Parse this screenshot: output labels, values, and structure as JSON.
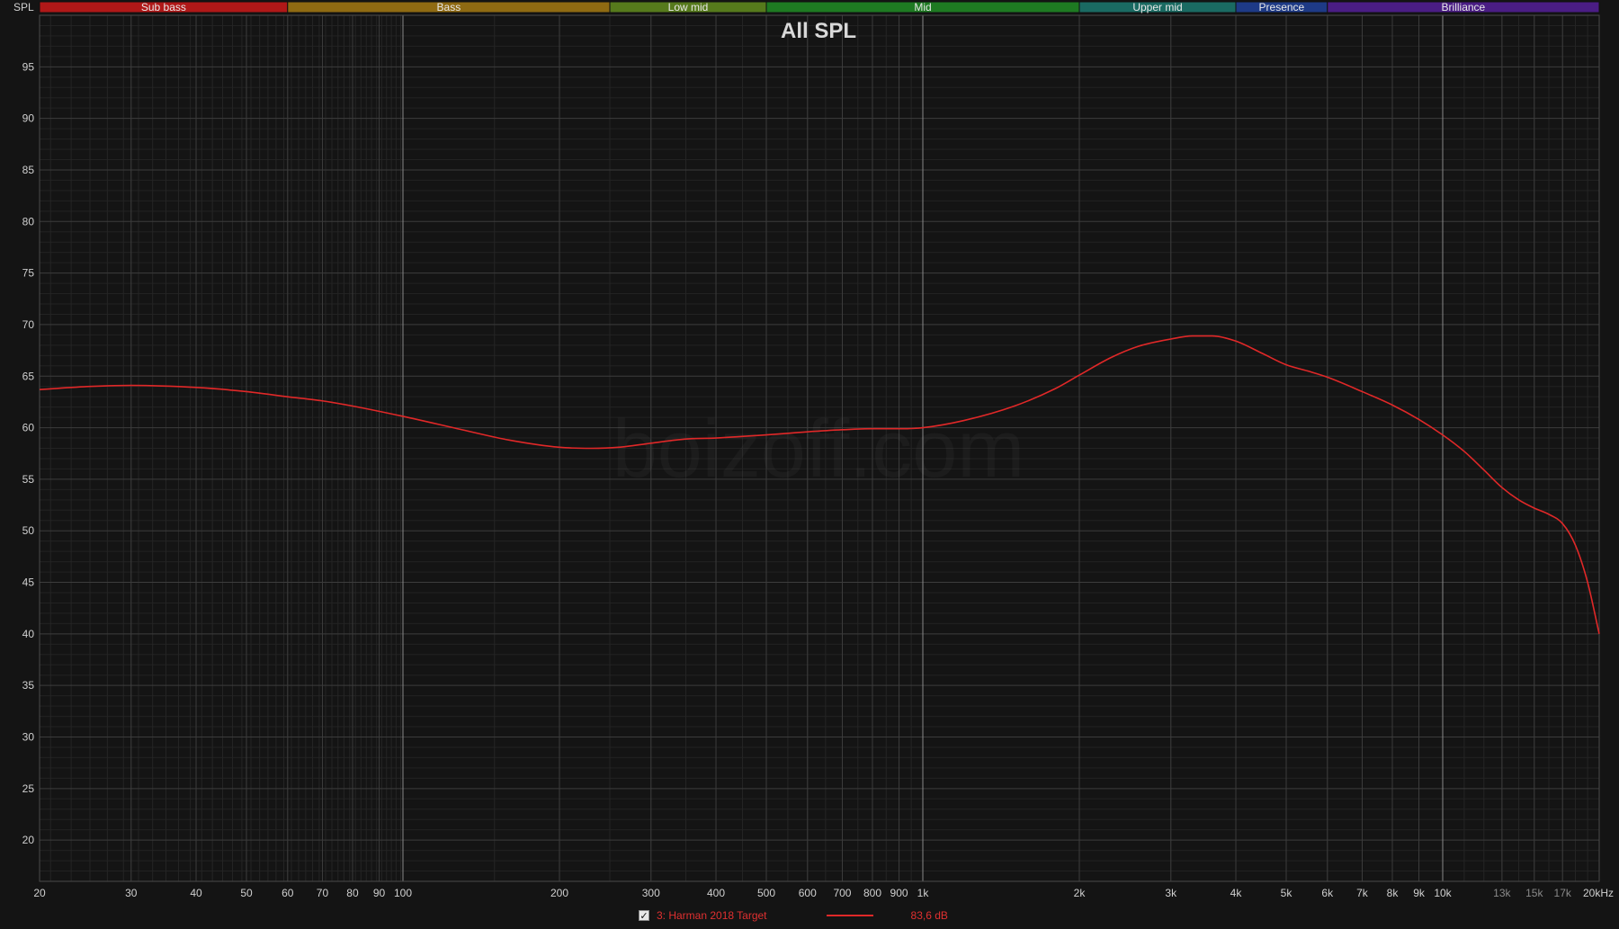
{
  "chart_data": {
    "type": "line",
    "title": "All SPL",
    "ylabel": "SPL",
    "xunit_label": "20kHz",
    "xscale": "log",
    "xlim": [
      20,
      20000
    ],
    "ylim": [
      16,
      100
    ],
    "grid": true,
    "watermark": "boizoff.com",
    "y_ticks": [
      20,
      25,
      30,
      35,
      40,
      45,
      50,
      55,
      60,
      65,
      70,
      75,
      80,
      85,
      90,
      95
    ],
    "x_ticks": [
      {
        "value": 20,
        "label": "20"
      },
      {
        "value": 30,
        "label": "30"
      },
      {
        "value": 40,
        "label": "40"
      },
      {
        "value": 50,
        "label": "50"
      },
      {
        "value": 60,
        "label": "60"
      },
      {
        "value": 70,
        "label": "70"
      },
      {
        "value": 80,
        "label": "80"
      },
      {
        "value": 90,
        "label": "90"
      },
      {
        "value": 100,
        "label": "100"
      },
      {
        "value": 200,
        "label": "200"
      },
      {
        "value": 300,
        "label": "300"
      },
      {
        "value": 400,
        "label": "400"
      },
      {
        "value": 500,
        "label": "500"
      },
      {
        "value": 600,
        "label": "600"
      },
      {
        "value": 700,
        "label": "700"
      },
      {
        "value": 800,
        "label": "800"
      },
      {
        "value": 900,
        "label": "900"
      },
      {
        "value": 1000,
        "label": "1k"
      },
      {
        "value": 2000,
        "label": "2k"
      },
      {
        "value": 3000,
        "label": "3k"
      },
      {
        "value": 4000,
        "label": "4k"
      },
      {
        "value": 5000,
        "label": "5k"
      },
      {
        "value": 6000,
        "label": "6k"
      },
      {
        "value": 7000,
        "label": "7k"
      },
      {
        "value": 8000,
        "label": "8k"
      },
      {
        "value": 9000,
        "label": "9k"
      },
      {
        "value": 10000,
        "label": "10k"
      },
      {
        "value": 13000,
        "label": "13k",
        "dim": true
      },
      {
        "value": 15000,
        "label": "15k",
        "dim": true
      },
      {
        "value": 17000,
        "label": "17k",
        "dim": true
      }
    ],
    "bands": [
      {
        "name": "Sub bass",
        "from": 20,
        "to": 60,
        "color": "#b01818"
      },
      {
        "name": "Bass",
        "from": 60,
        "to": 250,
        "color": "#8f6a12"
      },
      {
        "name": "Low mid",
        "from": 250,
        "to": 500,
        "color": "#567a1c"
      },
      {
        "name": "Mid",
        "from": 500,
        "to": 2000,
        "color": "#1e7a22"
      },
      {
        "name": "Upper mid",
        "from": 2000,
        "to": 4000,
        "color": "#1a6a62"
      },
      {
        "name": "Presence",
        "from": 4000,
        "to": 6000,
        "color": "#1e3a86"
      },
      {
        "name": "Brilliance",
        "from": 6000,
        "to": 20000,
        "color": "#4a1d84"
      }
    ],
    "series": [
      {
        "name": "3: Harman 2018 Target",
        "color": "#e02828",
        "value_label": "83,6 dB",
        "checked": true,
        "x": [
          20,
          25,
          30,
          40,
          50,
          60,
          70,
          80,
          100,
          130,
          160,
          200,
          230,
          260,
          300,
          350,
          400,
          500,
          600,
          700,
          800,
          900,
          1000,
          1200,
          1500,
          1800,
          2000,
          2300,
          2600,
          3000,
          3300,
          3600,
          4000,
          4500,
          5000,
          5500,
          6000,
          7000,
          8000,
          9000,
          10000,
          11000,
          12000,
          13000,
          14000,
          15000,
          16000,
          17000,
          18000,
          19000,
          20000
        ],
        "y": [
          63.7,
          64.0,
          64.1,
          63.9,
          63.5,
          63.0,
          62.6,
          62.1,
          61.1,
          59.8,
          58.8,
          58.1,
          58.0,
          58.1,
          58.5,
          58.9,
          59.0,
          59.3,
          59.6,
          59.8,
          59.9,
          59.9,
          60.0,
          60.7,
          62.1,
          63.8,
          65.1,
          66.8,
          67.9,
          68.6,
          68.9,
          68.9,
          68.4,
          67.2,
          66.1,
          65.5,
          64.9,
          63.5,
          62.2,
          60.8,
          59.3,
          57.7,
          55.9,
          54.2,
          53.0,
          52.2,
          51.6,
          50.7,
          48.6,
          45.0,
          40.0
        ]
      }
    ]
  }
}
